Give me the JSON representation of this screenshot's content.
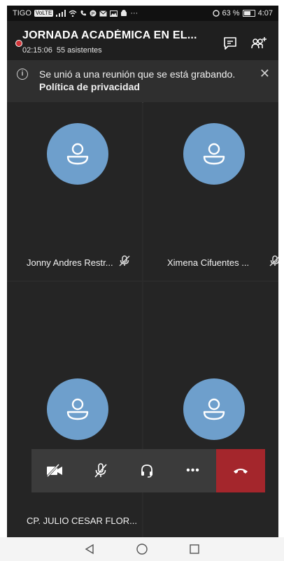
{
  "status_bar": {
    "carrier": "TIGO",
    "carrier_badge": "VoLTE",
    "more": "···",
    "battery_percent": "63 %",
    "time": "4:07"
  },
  "header": {
    "title": "JORNADA ACADÉMICA EN EL...",
    "duration": "02:15:06",
    "attendees": "55 asistentes",
    "recording_color": "#d13438"
  },
  "banner": {
    "message": "Se unió a una reunión que se está grabando.",
    "link": "Política de privacidad"
  },
  "participants": [
    {
      "name": "Jonny Andres Restr...",
      "muted": true
    },
    {
      "name": "Ximena Cifuentes ...",
      "muted": true
    },
    {
      "name": "CP. JULIO CESAR FLOR...",
      "muted": false
    },
    {
      "name": "",
      "muted": false
    }
  ],
  "controls": {
    "camera": "video-off-icon",
    "mic": "mic-off-icon",
    "audio": "headset-icon",
    "more": "•••",
    "end_call_color": "#a4262c"
  },
  "avatar_color": "#6e9fcc"
}
